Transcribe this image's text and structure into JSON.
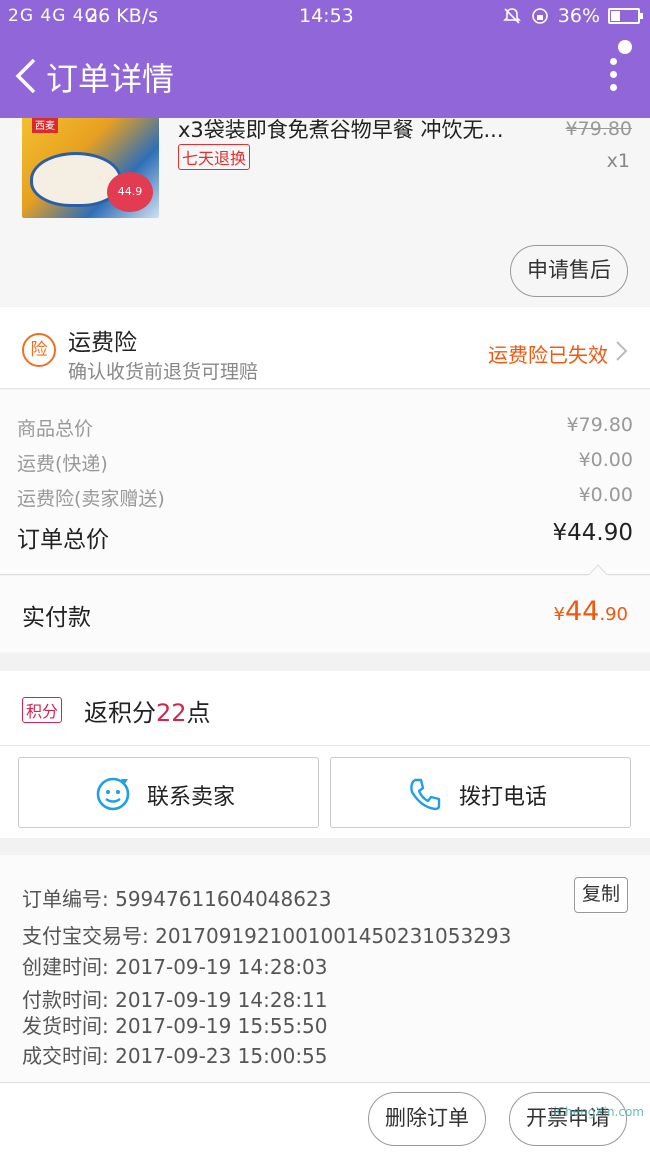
{
  "status_bar": {
    "signal": "2G 4G 4G",
    "speed": "26 KB/s",
    "time": "14:53",
    "battery": "36%",
    "battery_level": 0.36
  },
  "header": {
    "title": "订单详情"
  },
  "product": {
    "name": "x3袋装即食免煮谷物早餐 冲饮无...",
    "return_tag": "七天退换",
    "original_price": "¥79.80",
    "quantity": "x1",
    "after_sale_button": "申请售后",
    "thumb_brand": "西麦",
    "thumb_price": "44.9"
  },
  "insurance": {
    "title": "运费险",
    "subtitle": "确认收货前退货可理赔",
    "status": "运费险已失效",
    "icon_text": "险"
  },
  "prices": {
    "rows": [
      {
        "label": "商品总价",
        "value": "¥79.80"
      },
      {
        "label": "运费(快递)",
        "value": "¥0.00"
      },
      {
        "label": "运费险(卖家赠送)",
        "value": "¥0.00"
      }
    ],
    "total_label": "订单总价",
    "total_value": "¥44.90"
  },
  "actual_payment": {
    "label": "实付款",
    "currency": "¥",
    "integer": "44",
    "decimal": ".90"
  },
  "points": {
    "badge": "积分",
    "prefix": "返积分",
    "count": "22",
    "suffix": "点"
  },
  "contact": {
    "seller_label": "联系卖家",
    "phone_label": "拨打电话"
  },
  "order_info": {
    "order_no": "订单编号: 59947611604048623",
    "alipay_no": "支付宝交易号: 2017091921001001450231053293",
    "created": "创建时间: 2017-09-19 14:28:03",
    "paid": "付款时间: 2017-09-19 14:28:11",
    "shipped": "发货时间: 2017-09-19 15:55:50",
    "completed": "成交时间: 2017-09-23 15:00:55",
    "copy_label": "复制"
  },
  "bottom": {
    "delete_label": "删除订单",
    "invoice_label": "开票申请",
    "watermark": "JiChengXin.com"
  },
  "colors": {
    "header": "#9166d8",
    "accent_orange": "#f0580f",
    "points_red": "#d02650",
    "tag_red": "#e03030"
  }
}
